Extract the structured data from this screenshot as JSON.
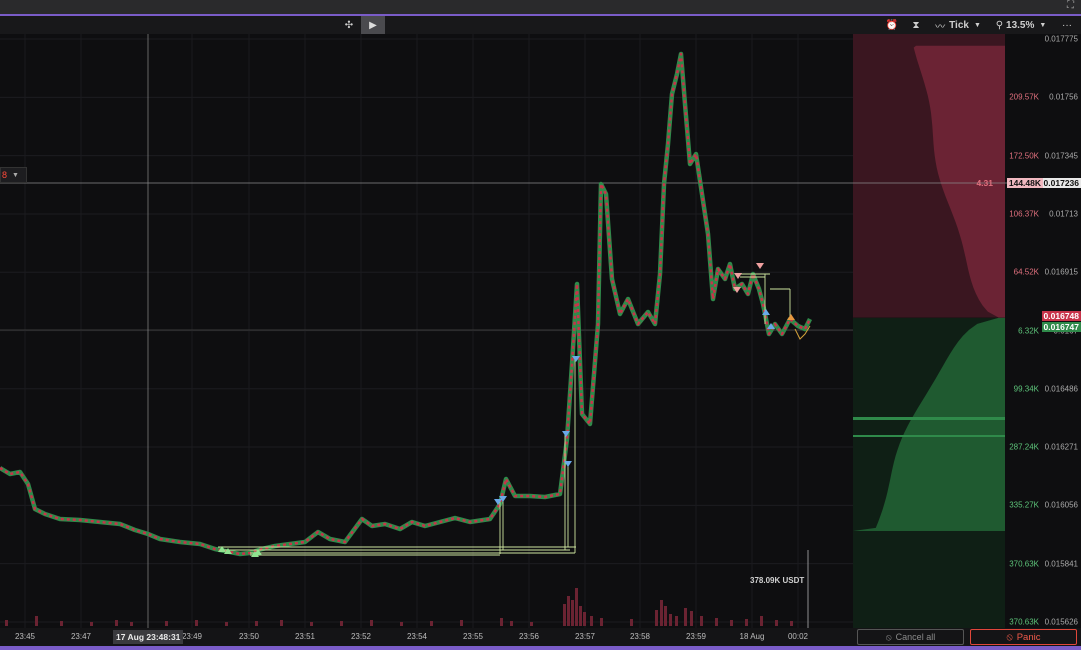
{
  "toolbar": {
    "play_icon": "▶",
    "timeframe_label": "Tick",
    "zoom_label": "13.5%",
    "more_icon": "···"
  },
  "left_chip": {
    "value": "8"
  },
  "price_axis": [
    {
      "label": "0.017775",
      "price": 0.017775
    },
    {
      "label": "0.01756",
      "price": 0.01756
    },
    {
      "label": "0.017345",
      "price": 0.017345
    },
    {
      "label": "0.01713",
      "price": 0.01713
    },
    {
      "label": "0.016915",
      "price": 0.016915
    },
    {
      "label": "0.0167",
      "price": 0.0167
    },
    {
      "label": "0.016486",
      "price": 0.016486
    },
    {
      "label": "0.016271",
      "price": 0.016271
    },
    {
      "label": "0.016056",
      "price": 0.016056
    },
    {
      "label": "0.015841",
      "price": 0.015841
    },
    {
      "label": "0.015626",
      "price": 0.015626
    }
  ],
  "book_volume_labels": [
    {
      "label": "209.57K",
      "side": "ask",
      "price": 0.01756
    },
    {
      "label": "172.50K",
      "side": "ask",
      "price": 0.017345
    },
    {
      "label": "106.37K",
      "side": "ask",
      "price": 0.01713
    },
    {
      "label": "64.52K",
      "side": "ask",
      "price": 0.016915
    },
    {
      "label": "6.32K",
      "side": "bid",
      "price": 0.0167
    },
    {
      "label": "99.34K",
      "side": "bid",
      "price": 0.016486
    },
    {
      "label": "287.24K",
      "side": "bid",
      "price": 0.016271
    },
    {
      "label": "335.27K",
      "side": "bid",
      "price": 0.016056
    },
    {
      "label": "370.63K",
      "side": "bid",
      "price": 0.015841
    },
    {
      "label": "370.63K",
      "side": "bid",
      "price": 0.015626
    }
  ],
  "crosshair": {
    "price_label": "0.017236",
    "volume_label": "144.48K",
    "ratio_label": "4.31"
  },
  "best_ask": {
    "label": "0.016748"
  },
  "best_bid": {
    "label": "0.016747"
  },
  "volume_total": {
    "label": "378.09K USDT"
  },
  "time_axis": [
    {
      "label": "23:45"
    },
    {
      "label": "23:47"
    },
    {
      "label": "23:49"
    },
    {
      "label": "23:50"
    },
    {
      "label": "23:51"
    },
    {
      "label": "23:52"
    },
    {
      "label": "23:54"
    },
    {
      "label": "23:55"
    },
    {
      "label": "23:56"
    },
    {
      "label": "23:57"
    },
    {
      "label": "23:58"
    },
    {
      "label": "23:59"
    },
    {
      "label": "18 Aug"
    },
    {
      "label": "00:02"
    }
  ],
  "time_cursor": {
    "label": "17 Aug 23:48:31"
  },
  "buttons": {
    "cancel_all": "Cancel all",
    "panic": "Panic"
  },
  "colors": {
    "ask": "#c8334a",
    "bid": "#2f8a4a",
    "accent": "#7a5cc8",
    "panic": "#f05a4a",
    "crosshair": "#8a8a8a"
  }
}
